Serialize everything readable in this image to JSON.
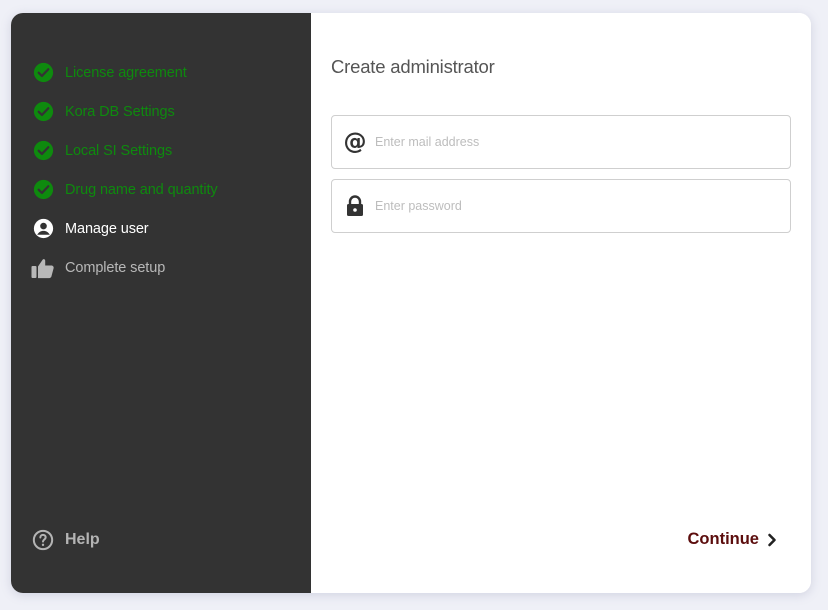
{
  "sidebar": {
    "steps": [
      {
        "label": "License agreement",
        "status": "done",
        "icon": "check-circle-icon"
      },
      {
        "label": "Kora DB Settings",
        "status": "done",
        "icon": "check-circle-icon"
      },
      {
        "label": "Local SI Settings",
        "status": "done",
        "icon": "check-circle-icon"
      },
      {
        "label": "Drug name and quantity",
        "status": "done",
        "icon": "check-circle-icon"
      },
      {
        "label": "Manage user",
        "status": "active",
        "icon": "user-circle-icon"
      },
      {
        "label": "Complete setup",
        "status": "todo",
        "icon": "thumbs-up-icon"
      }
    ],
    "help_label": "Help",
    "help_icon": "question-circle-icon"
  },
  "main": {
    "title": "Create administrator",
    "email": {
      "placeholder": "Enter mail address",
      "value": "",
      "icon": "at-icon"
    },
    "password": {
      "placeholder": "Enter password",
      "value": "",
      "icon": "lock-icon"
    },
    "continue_label": "Continue",
    "continue_icon": "chevron-right-icon"
  },
  "colors": {
    "sidebar_bg": "#333333",
    "done": "#0e8a0e",
    "active": "#ffffff",
    "todo": "#b8b8b8",
    "accent": "#5c0d0d"
  }
}
